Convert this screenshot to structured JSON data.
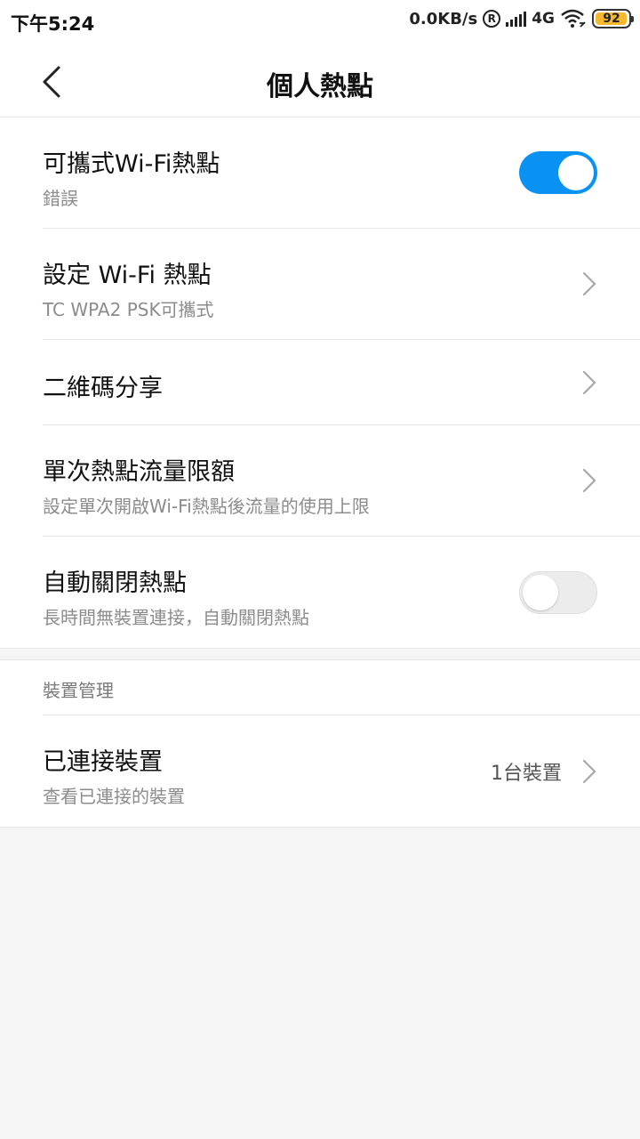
{
  "status_bar": {
    "time": "下午5:24",
    "speed": "0.0KB/s",
    "registered_mark": "R",
    "network": "4G",
    "battery": "92"
  },
  "header": {
    "title": "個人熱點"
  },
  "settings": {
    "portable_hotspot": {
      "title": "可攜式Wi-Fi熱點",
      "subtitle": "錯誤",
      "enabled": true
    },
    "configure_hotspot": {
      "title": "設定 Wi-Fi 熱點",
      "subtitle": "TC WPA2 PSK可攜式"
    },
    "qr_share": {
      "title": "二維碼分享"
    },
    "data_limit": {
      "title": "單次熱點流量限額",
      "subtitle": "設定單次開啟Wi-Fi熱點後流量的使用上限"
    },
    "auto_off": {
      "title": "自動關閉熱點",
      "subtitle": "長時間無裝置連接，自動關閉熱點",
      "enabled": false
    }
  },
  "device_management": {
    "header": "裝置管理",
    "connected_devices": {
      "title": "已連接裝置",
      "subtitle": "查看已連接的裝置",
      "count": "1台裝置"
    }
  },
  "colors": {
    "accent": "#0a92f3",
    "background": "#f5f5f5",
    "battery": "#f5b82e"
  }
}
